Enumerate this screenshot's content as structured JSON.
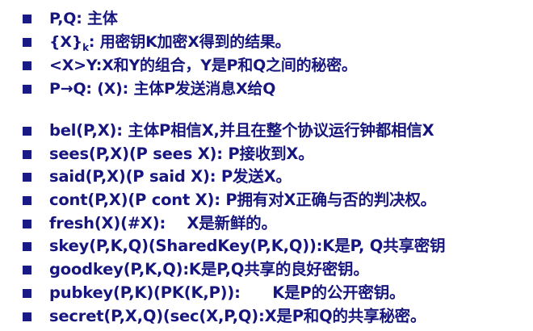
{
  "colors": {
    "text": "#17167e",
    "bullet": "#1a1a86",
    "background": "#ffffff"
  },
  "bullet_icon": "square-bullet-icon",
  "notation": [
    {
      "text": "P,Q:  主体"
    },
    {
      "prefix": "{X}",
      "subscript": "k",
      "suffix": ": 用密钥K加密X得到的结果。"
    },
    {
      "text": "<X>Y:X和Y的组合，Y是P和Q之间的秘密。"
    },
    {
      "text": "P→Q: (X): 主体P发送消息X给Q"
    }
  ],
  "predicates": [
    {
      "text": "bel(P,X): 主体P相信X,并且在整个协议运行钟都相信X"
    },
    {
      "text": "sees(P,X)(P sees X): P接收到X。"
    },
    {
      "text": "said(P,X)(P said X): P发送X。"
    },
    {
      "text": "cont(P,X)(P cont X): P拥有对X正确与否的判决权。"
    },
    {
      "text": "fresh(X)(#X):    X是新鲜的。"
    },
    {
      "text": "skey(P,K,Q)(SharedKey(P,K,Q)):K是P, Q共享密钥"
    },
    {
      "text": "goodkey(P,K,Q):K是P,Q共享的良好密钥。"
    },
    {
      "text": "pubkey(P,K)(PK(K,P)):      K是P的公开密钥。"
    },
    {
      "text": "secret(P,X,Q)(sec(X,P,Q):X是P和Q的共享秘密。"
    }
  ]
}
